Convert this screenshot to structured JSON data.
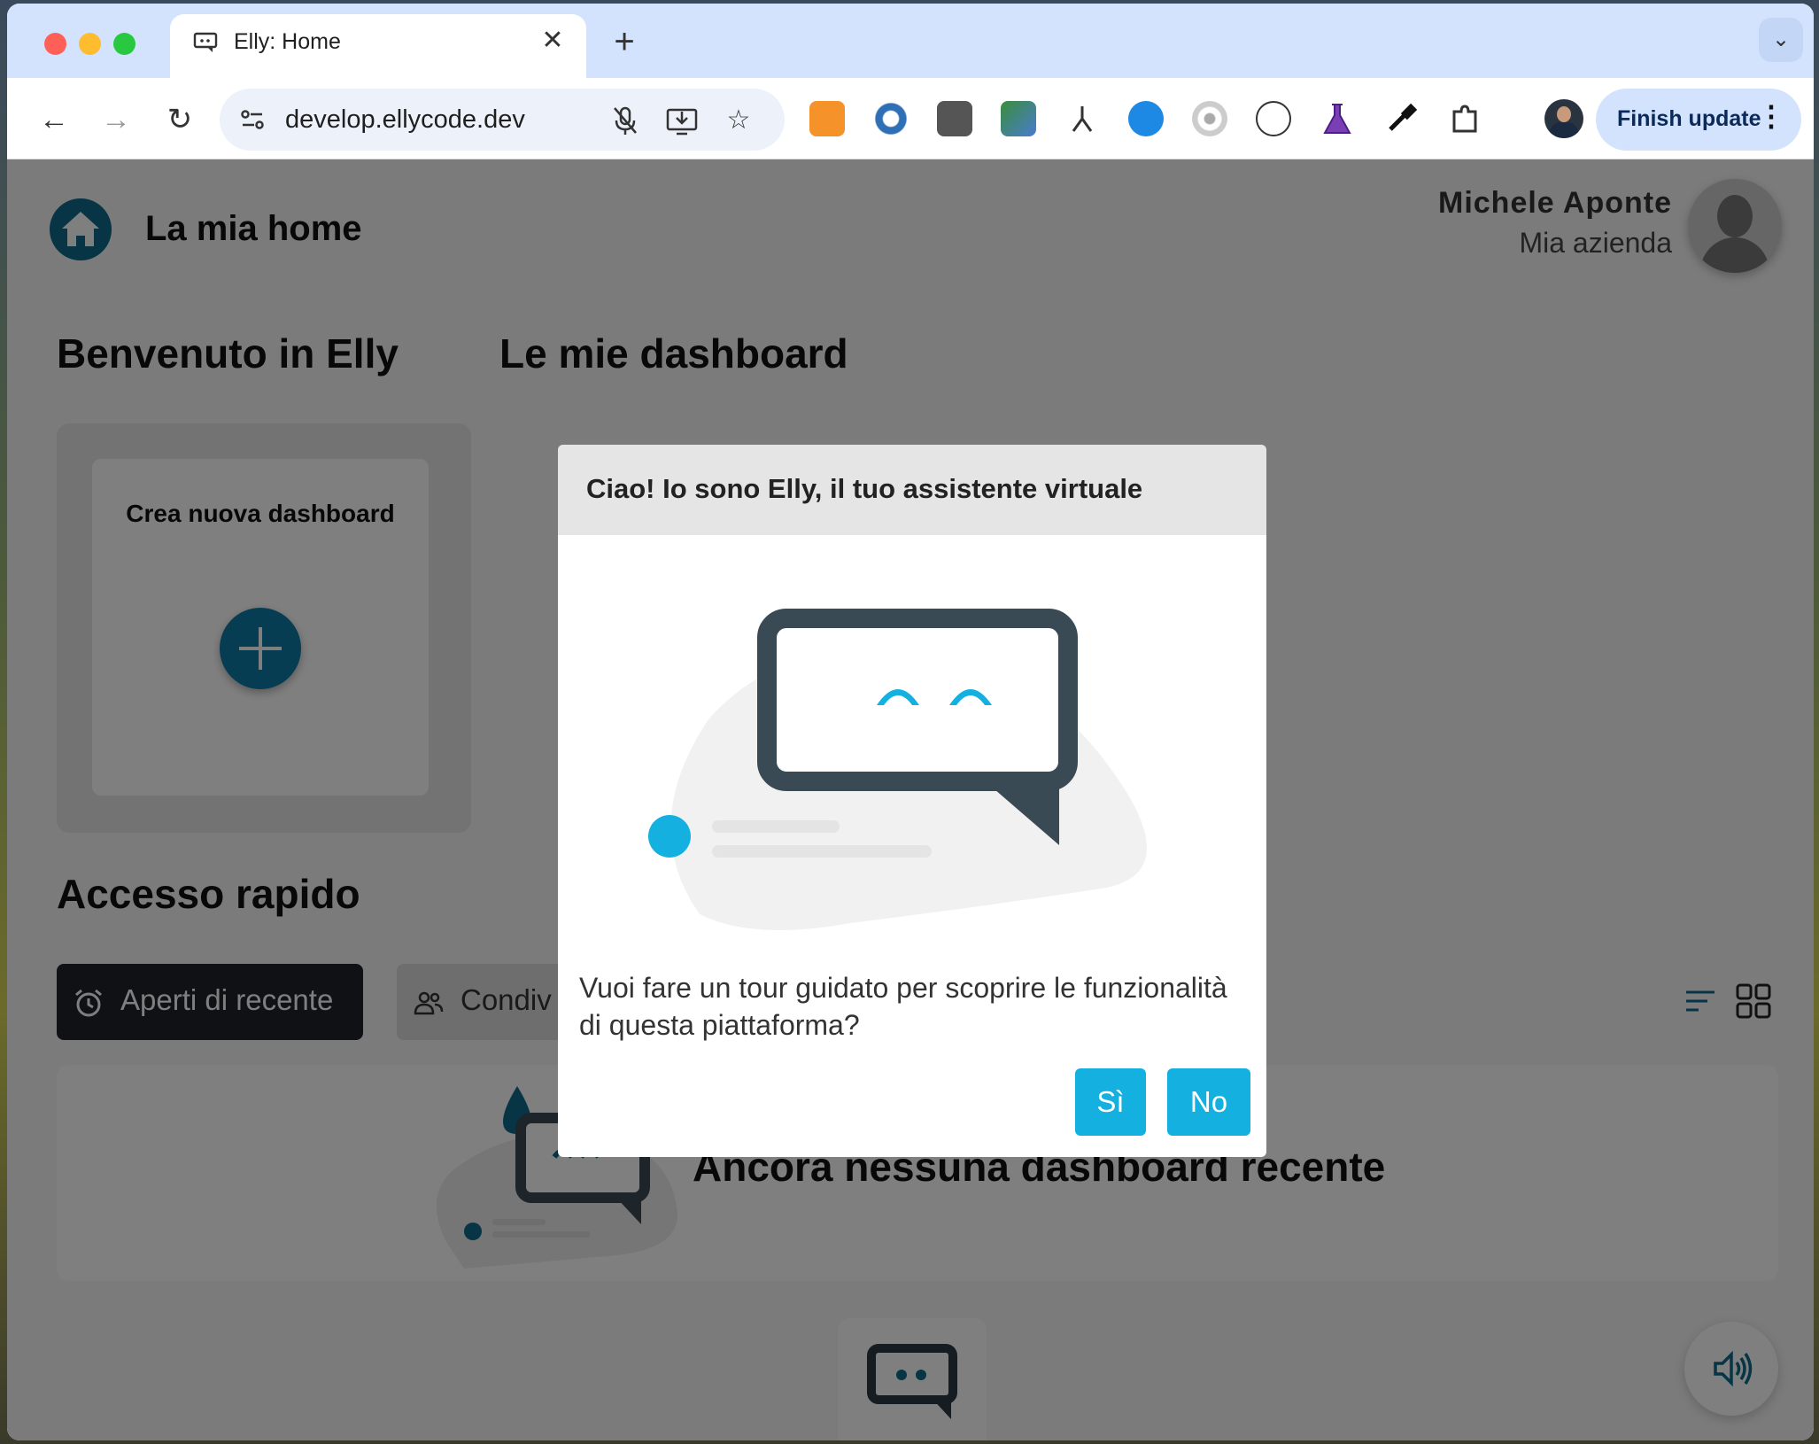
{
  "browser": {
    "tab_title": "Elly: Home",
    "url": "develop.ellycode.dev",
    "finish_update_label": "Finish update"
  },
  "header": {
    "title": "La mia home",
    "user_name": "Michele Aponte",
    "user_company": "Mia azienda"
  },
  "sections": {
    "welcome": "Benvenuto in Elly",
    "dashboards": "Le mie dashboard",
    "quick_access": "Accesso rapido"
  },
  "create_card": {
    "label": "Crea nuova dashboard"
  },
  "quick_tabs": [
    {
      "label": "Aperti di recente",
      "icon": "alarm-clock-icon"
    },
    {
      "label": "Condiv",
      "icon": "people-icon"
    }
  ],
  "empty_state": {
    "text": "Ancora nessuna dashboard recente"
  },
  "modal": {
    "title": "Ciao! Io sono Elly, il tuo assistente virtuale",
    "message": "Vuoi fare un tour guidato per scoprire le funzionalità di questa piattaforma?",
    "yes_label": "Sì",
    "no_label": "No"
  },
  "colors": {
    "accent": "#13b0e0",
    "brand_dark": "#0f6a8a",
    "bot_dark": "#3a4a55"
  }
}
